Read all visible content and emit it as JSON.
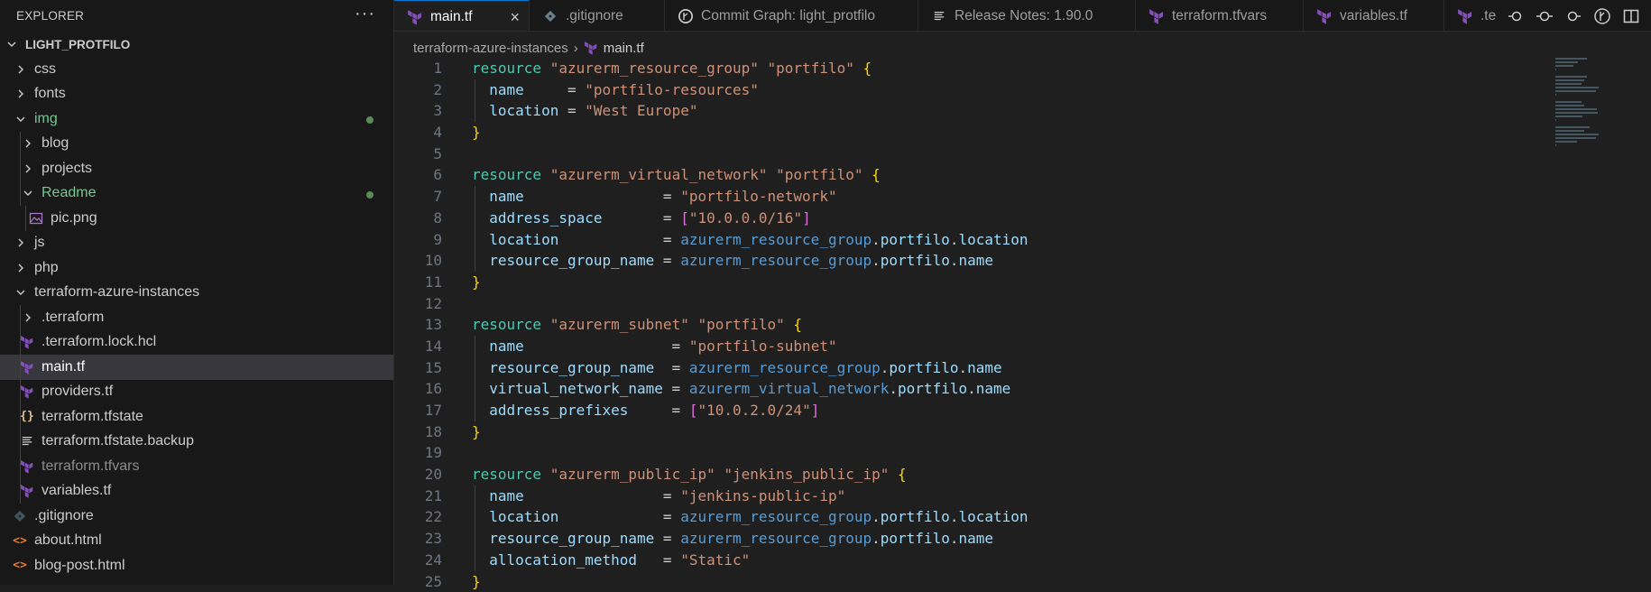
{
  "explorer": {
    "title": "EXPLORER",
    "more": "···",
    "project": "LIGHT_PROTFILO",
    "items": [
      {
        "label": "css",
        "depth": 1,
        "kind": "folder",
        "open": false
      },
      {
        "label": "fonts",
        "depth": 1,
        "kind": "folder",
        "open": false
      },
      {
        "label": "img",
        "depth": 1,
        "kind": "folder",
        "open": true,
        "modified": true
      },
      {
        "label": "blog",
        "depth": 2,
        "kind": "folder",
        "open": false
      },
      {
        "label": "projects",
        "depth": 2,
        "kind": "folder",
        "open": false
      },
      {
        "label": "Readme",
        "depth": 2,
        "kind": "folder",
        "open": true,
        "modified": true
      },
      {
        "label": "pic.png",
        "depth": 3,
        "kind": "image"
      },
      {
        "label": "js",
        "depth": 1,
        "kind": "folder",
        "open": false
      },
      {
        "label": "php",
        "depth": 1,
        "kind": "folder",
        "open": false
      },
      {
        "label": "terraform-azure-instances",
        "depth": 1,
        "kind": "folder",
        "open": true
      },
      {
        "label": ".terraform",
        "depth": 2,
        "kind": "folder",
        "open": false
      },
      {
        "label": ".terraform.lock.hcl",
        "depth": 2,
        "kind": "terraform"
      },
      {
        "label": "main.tf",
        "depth": 2,
        "kind": "terraform",
        "selected": true
      },
      {
        "label": "providers.tf",
        "depth": 2,
        "kind": "terraform"
      },
      {
        "label": "terraform.tfstate",
        "depth": 2,
        "kind": "json"
      },
      {
        "label": "terraform.tfstate.backup",
        "depth": 2,
        "kind": "text"
      },
      {
        "label": "terraform.tfvars",
        "depth": 2,
        "kind": "terraform",
        "ignored": true
      },
      {
        "label": "variables.tf",
        "depth": 2,
        "kind": "terraform"
      },
      {
        "label": ".gitignore",
        "depth": 1,
        "kind": "git"
      },
      {
        "label": "about.html",
        "depth": 1,
        "kind": "html"
      },
      {
        "label": "blog-post.html",
        "depth": 1,
        "kind": "html"
      }
    ]
  },
  "tabs": [
    {
      "label": "main.tf",
      "icon": "terraform",
      "active": true,
      "close": "×"
    },
    {
      "label": ".gitignore",
      "icon": "git"
    },
    {
      "label": "Commit Graph: light_protfilo",
      "icon": "gitlens"
    },
    {
      "label": "Release Notes: 1.90.0",
      "icon": "release-notes"
    },
    {
      "label": "terraform.tfvars",
      "icon": "terraform"
    },
    {
      "label": "variables.tf",
      "icon": "terraform"
    },
    {
      "label": ".te",
      "icon": "terraform"
    }
  ],
  "breadcrumb": {
    "folder": "terraform-azure-instances",
    "file": "main.tf",
    "separator": "›"
  },
  "code_lines": [
    [
      [
        "kw",
        "resource "
      ],
      [
        "str",
        "\"azurerm_resource_group\" \"portfilo\" "
      ],
      [
        "br1",
        "{"
      ]
    ],
    [
      [
        "op",
        "  "
      ],
      [
        "attr",
        "name"
      ],
      [
        "op",
        "     = "
      ],
      [
        "str",
        "\"portfilo-resources\""
      ]
    ],
    [
      [
        "op",
        "  "
      ],
      [
        "attr",
        "location"
      ],
      [
        "op",
        " = "
      ],
      [
        "str",
        "\"West Europe\""
      ]
    ],
    [
      [
        "br1",
        "}"
      ]
    ],
    [],
    [
      [
        "kw",
        "resource "
      ],
      [
        "str",
        "\"azurerm_virtual_network\" \"portfilo\" "
      ],
      [
        "br1",
        "{"
      ]
    ],
    [
      [
        "op",
        "  "
      ],
      [
        "attr",
        "name"
      ],
      [
        "op",
        "                = "
      ],
      [
        "str",
        "\"portfilo-network\""
      ]
    ],
    [
      [
        "op",
        "  "
      ],
      [
        "attr",
        "address_space"
      ],
      [
        "op",
        "       = "
      ],
      [
        "br2",
        "["
      ],
      [
        "str",
        "\"10.0.0.0/16\""
      ],
      [
        "br2",
        "]"
      ]
    ],
    [
      [
        "op",
        "  "
      ],
      [
        "attr",
        "location"
      ],
      [
        "op",
        "            = "
      ],
      [
        "ref",
        "azurerm_resource_group"
      ],
      [
        "op",
        "."
      ],
      [
        "attr",
        "portfilo"
      ],
      [
        "op",
        "."
      ],
      [
        "attr",
        "location"
      ]
    ],
    [
      [
        "op",
        "  "
      ],
      [
        "attr",
        "resource_group_name"
      ],
      [
        "op",
        " = "
      ],
      [
        "ref",
        "azurerm_resource_group"
      ],
      [
        "op",
        "."
      ],
      [
        "attr",
        "portfilo"
      ],
      [
        "op",
        "."
      ],
      [
        "attr",
        "name"
      ]
    ],
    [
      [
        "br1",
        "}"
      ]
    ],
    [],
    [
      [
        "kw",
        "resource "
      ],
      [
        "str",
        "\"azurerm_subnet\" \"portfilo\" "
      ],
      [
        "br1",
        "{"
      ]
    ],
    [
      [
        "op",
        "  "
      ],
      [
        "attr",
        "name"
      ],
      [
        "op",
        "                 = "
      ],
      [
        "str",
        "\"portfilo-subnet\""
      ]
    ],
    [
      [
        "op",
        "  "
      ],
      [
        "attr",
        "resource_group_name"
      ],
      [
        "op",
        "  = "
      ],
      [
        "ref",
        "azurerm_resource_group"
      ],
      [
        "op",
        "."
      ],
      [
        "attr",
        "portfilo"
      ],
      [
        "op",
        "."
      ],
      [
        "attr",
        "name"
      ]
    ],
    [
      [
        "op",
        "  "
      ],
      [
        "attr",
        "virtual_network_name"
      ],
      [
        "op",
        " = "
      ],
      [
        "ref",
        "azurerm_virtual_network"
      ],
      [
        "op",
        "."
      ],
      [
        "attr",
        "portfilo"
      ],
      [
        "op",
        "."
      ],
      [
        "attr",
        "name"
      ]
    ],
    [
      [
        "op",
        "  "
      ],
      [
        "attr",
        "address_prefixes"
      ],
      [
        "op",
        "     = "
      ],
      [
        "br2",
        "["
      ],
      [
        "str",
        "\"10.0.2.0/24\""
      ],
      [
        "br2",
        "]"
      ]
    ],
    [
      [
        "br1",
        "}"
      ]
    ],
    [],
    [
      [
        "kw",
        "resource "
      ],
      [
        "str",
        "\"azurerm_public_ip\" \"jenkins_public_ip\" "
      ],
      [
        "br1",
        "{"
      ]
    ],
    [
      [
        "op",
        "  "
      ],
      [
        "attr",
        "name"
      ],
      [
        "op",
        "                = "
      ],
      [
        "str",
        "\"jenkins-public-ip\""
      ]
    ],
    [
      [
        "op",
        "  "
      ],
      [
        "attr",
        "location"
      ],
      [
        "op",
        "            = "
      ],
      [
        "ref",
        "azurerm_resource_group"
      ],
      [
        "op",
        "."
      ],
      [
        "attr",
        "portfilo"
      ],
      [
        "op",
        "."
      ],
      [
        "attr",
        "location"
      ]
    ],
    [
      [
        "op",
        "  "
      ],
      [
        "attr",
        "resource_group_name"
      ],
      [
        "op",
        " = "
      ],
      [
        "ref",
        "azurerm_resource_group"
      ],
      [
        "op",
        "."
      ],
      [
        "attr",
        "portfilo"
      ],
      [
        "op",
        "."
      ],
      [
        "attr",
        "name"
      ]
    ],
    [
      [
        "op",
        "  "
      ],
      [
        "attr",
        "allocation_method"
      ],
      [
        "op",
        "   = "
      ],
      [
        "str",
        "\"Static\""
      ]
    ],
    [
      [
        "br1",
        "}"
      ]
    ]
  ],
  "colors": {
    "accent": "#0078d4",
    "keyword": "#4ec9b0",
    "string": "#ce9178",
    "attribute": "#9cdcfe",
    "reference": "#569cd6",
    "bracket": "#ffd700",
    "terraform": "#844fba"
  }
}
